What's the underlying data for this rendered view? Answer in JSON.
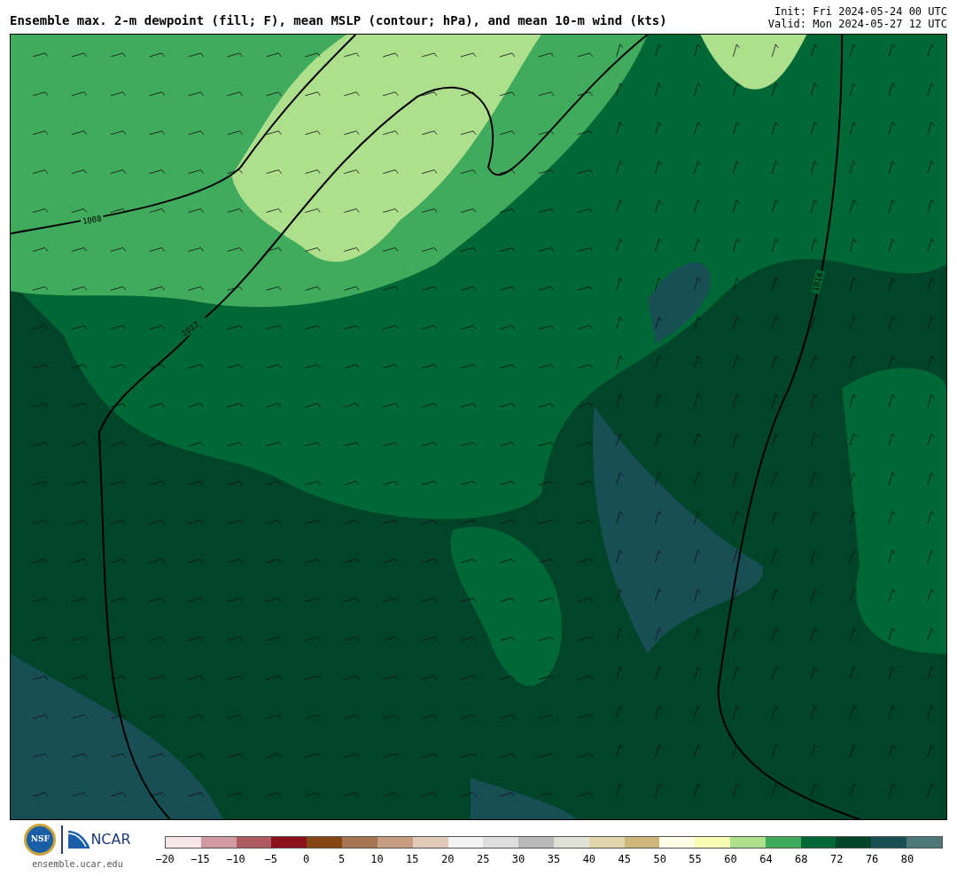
{
  "header": {
    "title": "Ensemble max. 2-m dewpoint (fill; F), mean MSLP (contour; hPa), and mean 10-m wind (kts)",
    "init": "Init: Fri 2024-05-24 00 UTC",
    "valid": "Valid: Mon 2024-05-27 12 UTC"
  },
  "map": {
    "contour_labels": [
      "1008",
      "1012",
      "1016"
    ]
  },
  "footer": {
    "nsf": "NSF",
    "ncar": "NCAR",
    "site": "ensemble.ucar.edu"
  },
  "colorbar": {
    "bins": [
      {
        "color": "#f5e6e8"
      },
      {
        "color": "#d29aa0"
      },
      {
        "color": "#ad5a60"
      },
      {
        "color": "#8a111c"
      },
      {
        "color": "#854513"
      },
      {
        "color": "#a87552"
      },
      {
        "color": "#c59d83"
      },
      {
        "color": "#e2c8b6"
      },
      {
        "color": "#f2f2f2"
      },
      {
        "color": "#dedede"
      },
      {
        "color": "#b8b8b8"
      },
      {
        "color": "#e0e2d5"
      },
      {
        "color": "#e2d4ad"
      },
      {
        "color": "#cdb67a"
      },
      {
        "color": "#fefde6"
      },
      {
        "color": "#f8fbb3"
      },
      {
        "color": "#addf8d"
      },
      {
        "color": "#41ab5d"
      },
      {
        "color": "#006835"
      },
      {
        "color": "#00442a"
      },
      {
        "color": "#184f55"
      },
      {
        "color": "#4d7878"
      }
    ],
    "ticks": [
      "−20",
      "−15",
      "−10",
      "−5",
      "0",
      "5",
      "10",
      "15",
      "20",
      "25",
      "30",
      "35",
      "40",
      "45",
      "50",
      "55",
      "60",
      "64",
      "68",
      "72",
      "76",
      "80"
    ]
  }
}
